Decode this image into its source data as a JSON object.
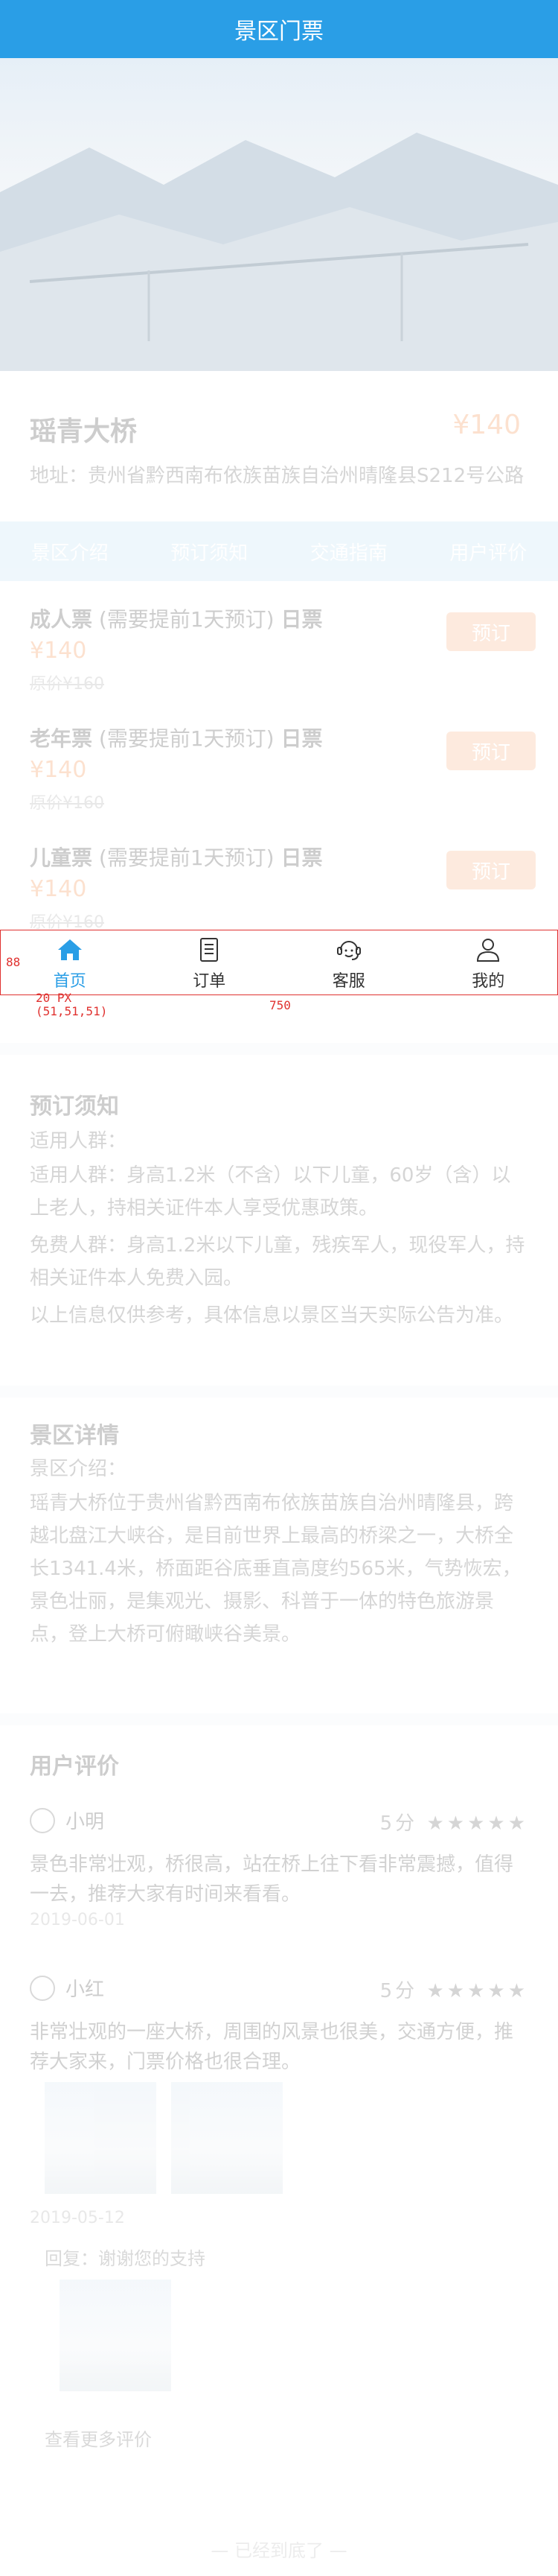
{
  "header": {
    "title": "景区门票"
  },
  "spot": {
    "name": "瑶青大桥",
    "price": "¥140",
    "address": "地址：贵州省黔西南布依族苗族自治州晴隆县S212号公路"
  },
  "tabs": [
    "景区介绍",
    "预订须知",
    "交通指南",
    "用户评价"
  ],
  "tickets": [
    {
      "name": "成人票",
      "tag": "(需要提前1天预订)",
      "kind": "日票",
      "price": "¥140",
      "orig": "原价¥160",
      "btn": "预订"
    },
    {
      "name": "老年票",
      "tag": "(需要提前1天预订)",
      "kind": "日票",
      "price": "¥140",
      "orig": "原价¥160",
      "btn": "预订"
    },
    {
      "name": "儿童票",
      "tag": "(需要提前1天预订)",
      "kind": "日票",
      "price": "¥140",
      "orig": "原价¥160",
      "btn": "预订"
    }
  ],
  "notice": {
    "title": "预订须知",
    "sub": "适用人群：",
    "p1": "适用人群：身高1.2米（不含）以下儿童，60岁（含）以上老人，持相关证件本人享受优惠政策。",
    "p2": "免费人群：身高1.2米以下儿童，残疾军人，现役军人，持相关证件本人免费入园。",
    "p3": "以上信息仅供参考，具体信息以景区当天实际公告为准。"
  },
  "intro": {
    "title": "景区详情",
    "sub": "景区介绍：",
    "p1": "瑶青大桥位于贵州省黔西南布依族苗族自治州晴隆县，跨越北盘江大峡谷，是目前世界上最高的桥梁之一，大桥全长1341.4米，桥面距谷底垂直高度约565米，气势恢宏，景色壮丽，是集观光、摄影、科普于一体的特色旅游景点，登上大桥可俯瞰峡谷美景。"
  },
  "reviews": {
    "title": "用户评价",
    "items": [
      {
        "user": "小明",
        "score": "5分",
        "stars": "★★★★★",
        "text": "景色非常壮观，桥很高，站在桥上往下看非常震撼，值得一去，推荐大家有时间来看看。",
        "date": "2019-06-01"
      },
      {
        "user": "小红",
        "score": "5分",
        "stars": "★★★★★",
        "text": "非常壮观的一座大桥，周围的风景也很美，交通方便，推荐大家来，门票价格也很合理。",
        "date": "2019-05-12"
      }
    ],
    "sub_review": "回复：谢谢您的支持",
    "more": "查看更多评价"
  },
  "footer": {
    "text": "— 已经到底了 —"
  },
  "tabbar": {
    "items": [
      {
        "label": "首页",
        "icon": "home-icon"
      },
      {
        "label": "订单",
        "icon": "order-icon"
      },
      {
        "label": "客服",
        "icon": "service-icon"
      },
      {
        "label": "我的",
        "icon": "user-icon"
      }
    ]
  },
  "annotation": {
    "height": "88",
    "padding": "20 PX",
    "color": "(51,51,51)",
    "width": "750"
  },
  "colors": {
    "brand": "#2a9ee6",
    "price": "#f27b2a",
    "annotation": "#e0312f"
  }
}
